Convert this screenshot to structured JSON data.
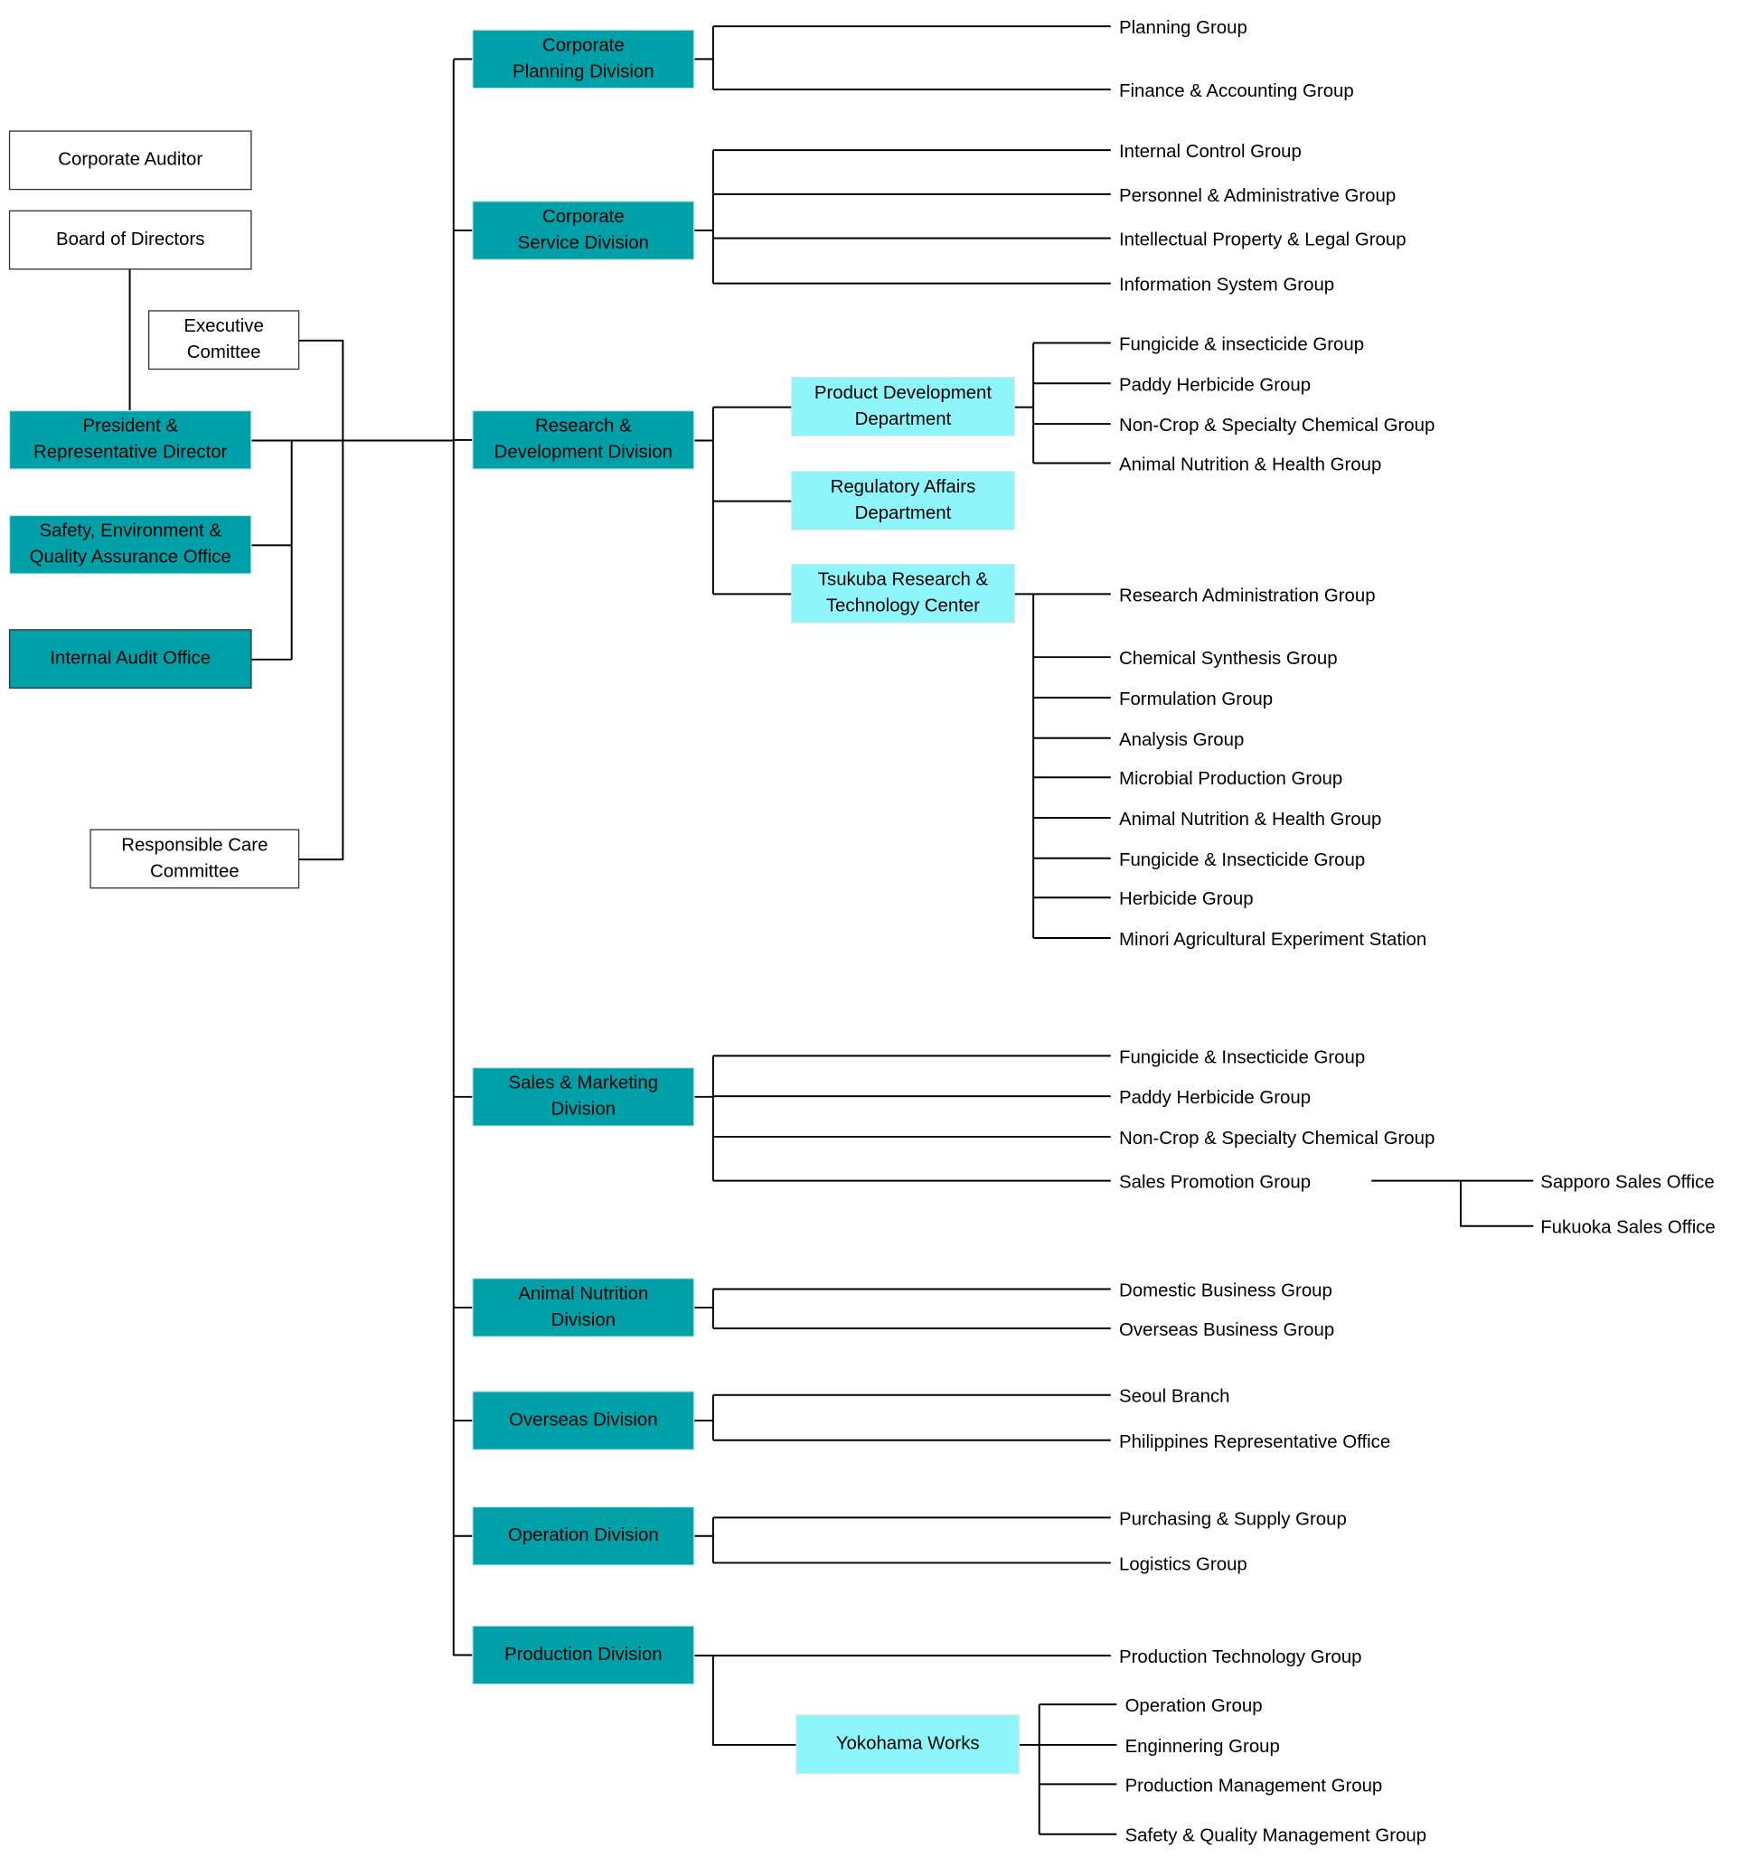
{
  "colors": {
    "division": "#00A0A8",
    "department": "#8EF6FA",
    "plain": "#FFFFFF",
    "line": "#000000"
  },
  "left": {
    "corporate_auditor": "Corporate Auditor",
    "board": "Board of Directors",
    "executive": [
      "Executive",
      "Comittee"
    ],
    "president": [
      "President &",
      "Representative Director"
    ],
    "safety": [
      "Safety, Environment &",
      "Quality Assurance Office"
    ],
    "internal_audit": "Internal Audit Office",
    "responsible_care": [
      "Responsible Care",
      "Committee"
    ]
  },
  "divisions": [
    {
      "name": [
        "Corporate",
        "Planning Division"
      ],
      "groups": [
        "Planning Group",
        "Finance & Accounting Group"
      ]
    },
    {
      "name": [
        "Corporate",
        "Service Division"
      ],
      "groups": [
        "Internal Control Group",
        "Personnel & Administrative Group",
        "Intellectual Property & Legal Group",
        "Information System Group"
      ]
    },
    {
      "name": [
        "Research &",
        "Development Division"
      ]
    },
    {
      "name": [
        "Sales & Marketing",
        "Division"
      ],
      "groups": [
        "Fungicide & Insecticide Group",
        "Paddy Herbicide Group",
        "Non-Crop & Specialty Chemical Group",
        "Sales Promotion Group"
      ],
      "offices": [
        "Sapporo Sales Office",
        "Fukuoka Sales Office"
      ]
    },
    {
      "name": [
        "Animal Nutrition",
        "Division"
      ],
      "groups": [
        "Domestic Business Group",
        "Overseas Business Group"
      ]
    },
    {
      "name": [
        "Overseas Division"
      ],
      "groups": [
        "Seoul Branch",
        "Philippines Representative Office"
      ]
    },
    {
      "name": [
        "Operation Division"
      ],
      "groups": [
        "Purchasing & Supply Group",
        "Logistics Group"
      ]
    },
    {
      "name": [
        "Production Division"
      ],
      "groups": [
        "Production Technology Group"
      ]
    }
  ],
  "departments": {
    "product_dev": {
      "name": [
        "Product Development",
        "Department"
      ],
      "groups": [
        "Fungicide & insecticide Group",
        "Paddy Herbicide Group",
        "Non-Crop & Specialty Chemical Group",
        "Animal Nutrition & Health Group"
      ]
    },
    "regulatory": {
      "name": [
        "Regulatory Affairs",
        "Department"
      ]
    },
    "tsukuba": {
      "name": [
        "Tsukuba Research &",
        "Technology Center"
      ],
      "groups": [
        "Research Administration Group",
        "Chemical Synthesis Group",
        "Formulation Group",
        "Analysis Group",
        "Microbial Production Group",
        "Animal Nutrition & Health Group",
        "Fungicide & Insecticide Group",
        "Herbicide Group",
        "Minori Agricultural Experiment Station"
      ]
    },
    "yokohama": {
      "name": [
        "Yokohama Works"
      ],
      "groups": [
        "Operation Group",
        "Enginnering  Group",
        "Production Management  Group",
        "Safety & Quality Management Group"
      ]
    }
  }
}
